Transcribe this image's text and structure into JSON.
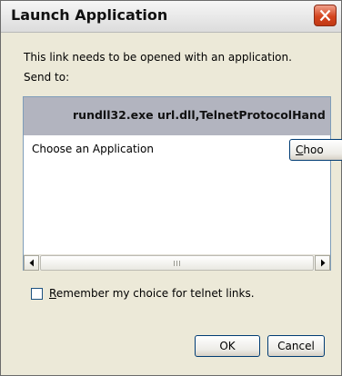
{
  "window": {
    "title": "Launch Application"
  },
  "message": {
    "line1": "This link needs to be opened with an application.",
    "line2": "Send to:"
  },
  "app_list": {
    "header_text": "rundll32.exe url.dll,TelnetProtocolHand",
    "choose_label": "Choose an Application",
    "choose_button": {
      "accesskey": "C",
      "rest": "hoo"
    }
  },
  "remember": {
    "checked": false,
    "accesskey": "R",
    "rest": "emember my choice for telnet links."
  },
  "buttons": {
    "ok": "OK",
    "cancel": "Cancel"
  },
  "colors": {
    "dialog_bg": "#ece9d8",
    "header_bg": "#b2b4bf",
    "close_button": "#d4451f"
  }
}
